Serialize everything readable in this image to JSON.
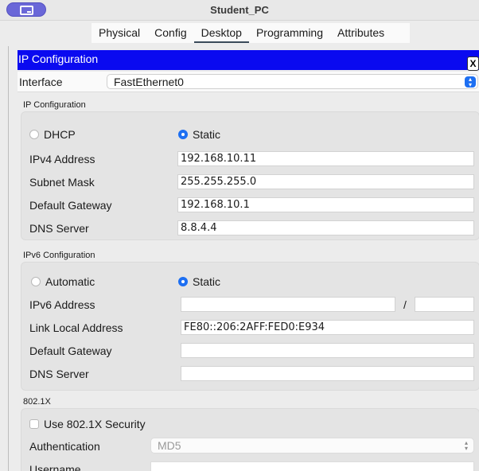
{
  "window": {
    "title": "Student_PC"
  },
  "tabs": [
    "Physical",
    "Config",
    "Desktop",
    "Programming",
    "Attributes"
  ],
  "active_tab": "Desktop",
  "app": {
    "title": "IP Configuration",
    "close_label": "X"
  },
  "interface": {
    "label": "Interface",
    "value": "FastEthernet0"
  },
  "ipv4": {
    "section_label": "IP Configuration",
    "dhcp_label": "DHCP",
    "static_label": "Static",
    "mode": "Static",
    "address_label": "IPv4 Address",
    "address": "192.168.10.11",
    "mask_label": "Subnet Mask",
    "mask": "255.255.255.0",
    "gateway_label": "Default Gateway",
    "gateway": "192.168.10.1",
    "dns_label": "DNS Server",
    "dns": "8.8.4.4"
  },
  "ipv6": {
    "section_label": "IPv6 Configuration",
    "auto_label": "Automatic",
    "static_label": "Static",
    "mode": "Static",
    "address_label": "IPv6 Address",
    "address": "",
    "prefix_separator": "/",
    "prefix": "",
    "link_local_label": "Link Local Address",
    "link_local": "FE80::206:2AFF:FED0:E934",
    "gateway_label": "Default Gateway",
    "gateway": "",
    "dns_label": "DNS Server",
    "dns": ""
  },
  "dot1x": {
    "section_label": "802.1X",
    "use_label": "Use 802.1X Security",
    "enabled": false,
    "auth_label": "Authentication",
    "auth_value": "MD5",
    "username_label": "Username"
  },
  "colors": {
    "accent": "#1d6ff2",
    "header": "#0a0af0",
    "title_button": "#6a67d8"
  }
}
